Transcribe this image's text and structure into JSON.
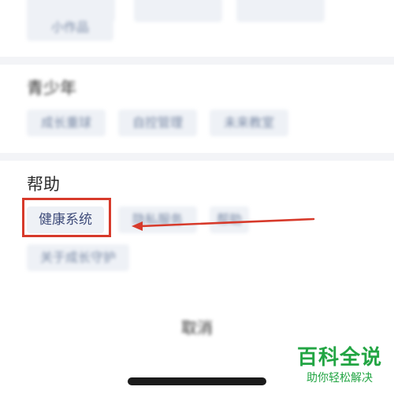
{
  "sections": {
    "top": {
      "chips": [
        "小作品"
      ]
    },
    "teen": {
      "title": "青少年",
      "chips": [
        "成长重球",
        "自控管理",
        "未来教室"
      ]
    },
    "help": {
      "title": "帮助",
      "chips": [
        "健康系统",
        "隐私服务",
        "帮助",
        "关于成长守护"
      ]
    }
  },
  "cancel_label": "取消",
  "watermark": {
    "title": "百科全说",
    "subtitle": "助你轻松解决"
  },
  "colors": {
    "highlight": "#d73a2b",
    "watermark": "#22a543"
  }
}
